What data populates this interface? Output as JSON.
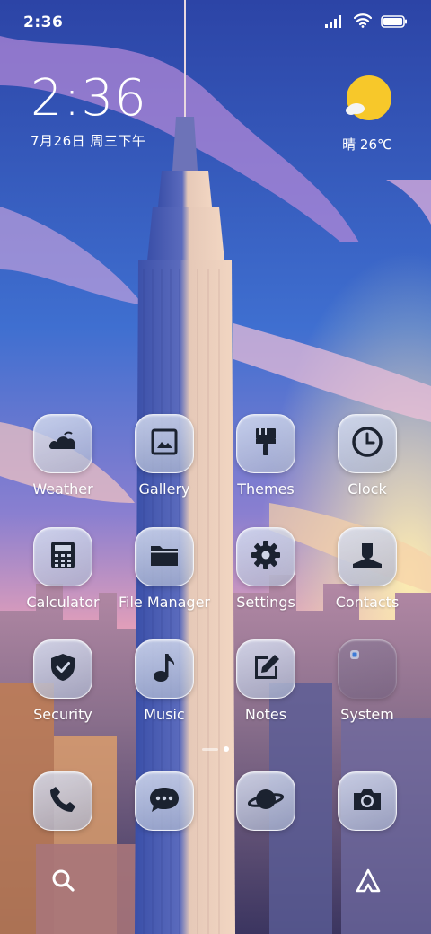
{
  "status_bar": {
    "time": "2:36"
  },
  "clock_widget": {
    "time": "2:36",
    "date": "7月26日 周三下午"
  },
  "weather_widget": {
    "condition": "晴",
    "temperature": "26℃",
    "text": "晴 26℃",
    "icon": "sun-cloud-icon"
  },
  "apps": [
    {
      "label": "Weather",
      "icon": "cloud-icon"
    },
    {
      "label": "Gallery",
      "icon": "image-icon"
    },
    {
      "label": "Themes",
      "icon": "paintbrush-icon"
    },
    {
      "label": "Clock",
      "icon": "clock-icon"
    },
    {
      "label": "Calculator",
      "icon": "calculator-icon"
    },
    {
      "label": "File Manager",
      "icon": "folder-icon"
    },
    {
      "label": "Settings",
      "icon": "gear-icon"
    },
    {
      "label": "Contacts",
      "icon": "person-icon"
    },
    {
      "label": "Security",
      "icon": "shield-check-icon"
    },
    {
      "label": "Music",
      "icon": "music-note-icon"
    },
    {
      "label": "Notes",
      "icon": "pencil-square-icon"
    },
    {
      "label": "System",
      "icon": "folder-group-icon"
    }
  ],
  "dock": [
    {
      "icon": "phone-icon"
    },
    {
      "icon": "chat-bubble-icon"
    },
    {
      "icon": "planet-icon"
    },
    {
      "icon": "camera-icon"
    }
  ],
  "bottom_nav": {
    "left_icon": "search-icon",
    "right_icon": "assistant-icon"
  },
  "colors": {
    "icon_glyph": "#1b2230",
    "sun": "#f7c82a",
    "sky_top": "#2d45a8",
    "sky_bottom": "#f0b27a"
  }
}
